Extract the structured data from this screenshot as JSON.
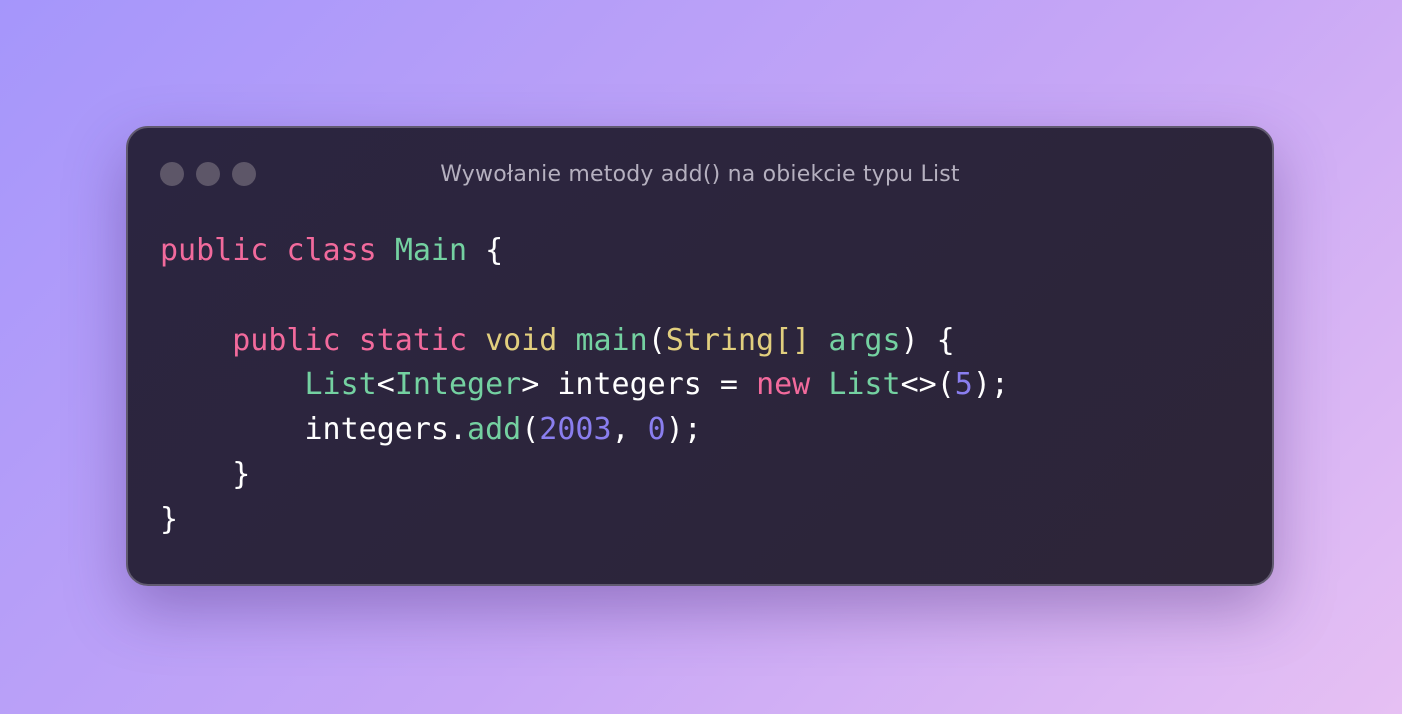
{
  "window": {
    "title": "Wywołanie metody add() na obiekcie typu List",
    "controls": [
      "window-dot",
      "window-dot",
      "window-dot"
    ]
  },
  "colors": {
    "keyword": "#f26a9c",
    "type": "#74d1a1",
    "primitive": "#e2cf7e",
    "number": "#8a7eef",
    "plain": "#ffffff",
    "background_start": "#a596fb",
    "background_end": "#e6c0f3",
    "window": "#2b2540"
  },
  "code": {
    "lines": [
      {
        "tokens": [
          {
            "text": "public",
            "kind": "kw"
          },
          {
            "text": " ",
            "kind": "pl"
          },
          {
            "text": "class",
            "kind": "kw"
          },
          {
            "text": " ",
            "kind": "pl"
          },
          {
            "text": "Main",
            "kind": "ty"
          },
          {
            "text": " {",
            "kind": "pl"
          }
        ]
      },
      {
        "tokens": []
      },
      {
        "tokens": [
          {
            "text": "    ",
            "kind": "pl"
          },
          {
            "text": "public",
            "kind": "kw"
          },
          {
            "text": " ",
            "kind": "pl"
          },
          {
            "text": "static",
            "kind": "kw"
          },
          {
            "text": " ",
            "kind": "pl"
          },
          {
            "text": "void",
            "kind": "yl"
          },
          {
            "text": " ",
            "kind": "pl"
          },
          {
            "text": "main",
            "kind": "ty"
          },
          {
            "text": "(",
            "kind": "pl"
          },
          {
            "text": "String[]",
            "kind": "yl"
          },
          {
            "text": " ",
            "kind": "pl"
          },
          {
            "text": "args",
            "kind": "ty"
          },
          {
            "text": ") {",
            "kind": "pl"
          }
        ]
      },
      {
        "tokens": [
          {
            "text": "        ",
            "kind": "pl"
          },
          {
            "text": "List",
            "kind": "ty"
          },
          {
            "text": "<",
            "kind": "pl"
          },
          {
            "text": "Integer",
            "kind": "ty"
          },
          {
            "text": "> integers = ",
            "kind": "pl"
          },
          {
            "text": "new",
            "kind": "kw"
          },
          {
            "text": " ",
            "kind": "pl"
          },
          {
            "text": "List",
            "kind": "ty"
          },
          {
            "text": "<>(",
            "kind": "pl"
          },
          {
            "text": "5",
            "kind": "nm"
          },
          {
            "text": ");",
            "kind": "pl"
          }
        ]
      },
      {
        "tokens": [
          {
            "text": "        integers.",
            "kind": "pl"
          },
          {
            "text": "add",
            "kind": "ty"
          },
          {
            "text": "(",
            "kind": "pl"
          },
          {
            "text": "2003",
            "kind": "nm"
          },
          {
            "text": ", ",
            "kind": "pl"
          },
          {
            "text": "0",
            "kind": "nm"
          },
          {
            "text": ");",
            "kind": "pl"
          }
        ]
      },
      {
        "tokens": [
          {
            "text": "    }",
            "kind": "pl"
          }
        ]
      },
      {
        "tokens": [
          {
            "text": "}",
            "kind": "pl"
          }
        ]
      }
    ]
  }
}
